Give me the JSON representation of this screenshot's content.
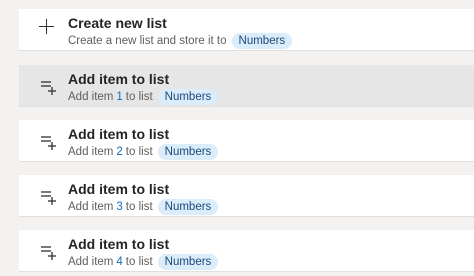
{
  "steps": [
    {
      "kind": "create",
      "icon": "plus-icon",
      "title": "Create new list",
      "sub_prefix": "Create a new list and store it to",
      "variable": "Numbers"
    },
    {
      "kind": "add",
      "icon": "add-item-icon",
      "title": "Add item to list",
      "sub_prefix": "Add item",
      "number": "1",
      "sub_mid": "to list",
      "variable": "Numbers",
      "selected": true
    },
    {
      "kind": "add",
      "icon": "add-item-icon",
      "title": "Add item to list",
      "sub_prefix": "Add item",
      "number": "2",
      "sub_mid": "to list",
      "variable": "Numbers"
    },
    {
      "kind": "add",
      "icon": "add-item-icon",
      "title": "Add item to list",
      "sub_prefix": "Add item",
      "number": "3",
      "sub_mid": "to list",
      "variable": "Numbers"
    },
    {
      "kind": "add",
      "icon": "add-item-icon",
      "title": "Add item to list",
      "sub_prefix": "Add item",
      "number": "4",
      "sub_mid": "to list",
      "variable": "Numbers"
    }
  ],
  "colors": {
    "accent": "#0f6cbd",
    "chip_bg": "#dbecfa",
    "selected_bg": "#e6e6e6"
  }
}
